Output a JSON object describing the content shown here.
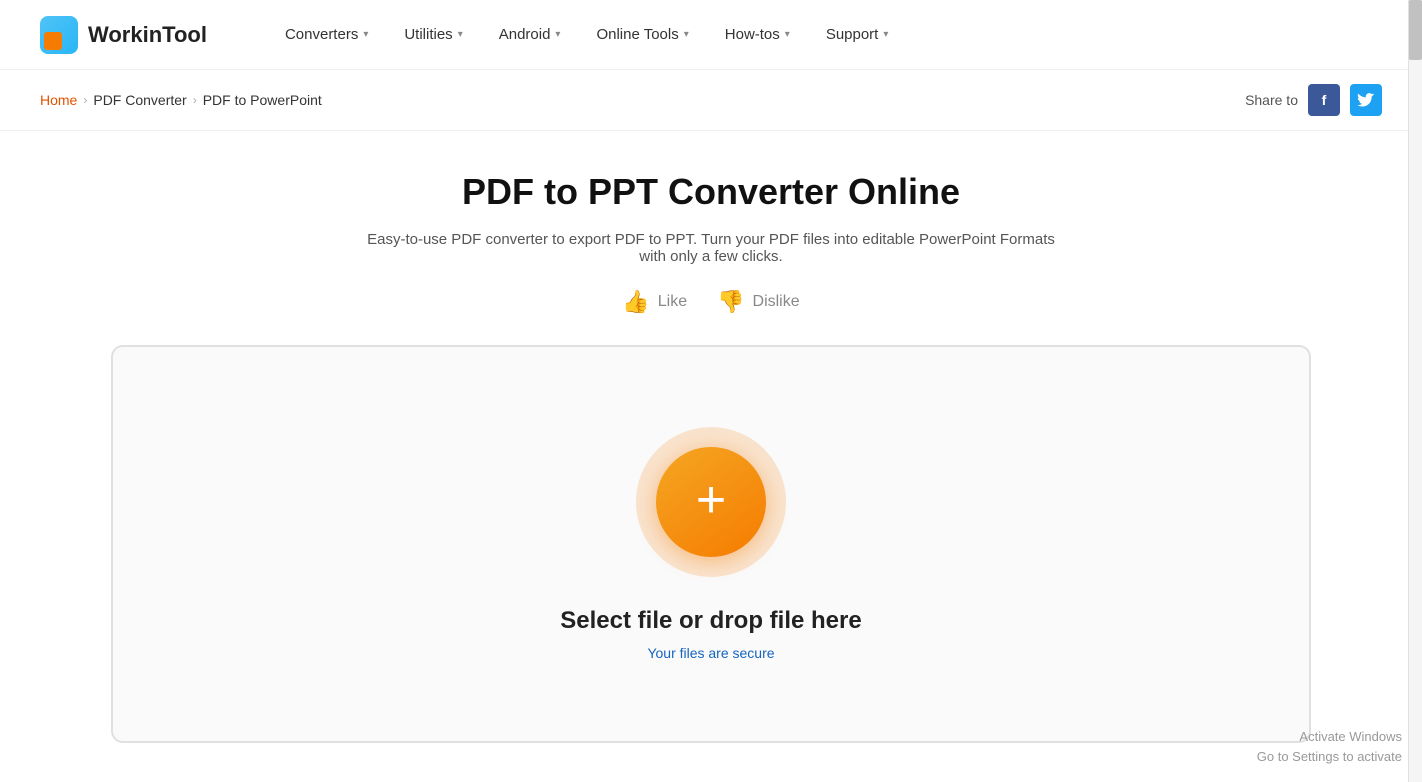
{
  "logo": {
    "text": "WorkinTool"
  },
  "nav": {
    "items": [
      {
        "label": "Converters",
        "has_dropdown": true
      },
      {
        "label": "Utilities",
        "has_dropdown": true
      },
      {
        "label": "Android",
        "has_dropdown": true
      },
      {
        "label": "Online Tools",
        "has_dropdown": true
      },
      {
        "label": "How-tos",
        "has_dropdown": true
      },
      {
        "label": "Support",
        "has_dropdown": true
      }
    ]
  },
  "breadcrumb": {
    "home": "Home",
    "separator1": "›",
    "middle": "PDF Converter",
    "separator2": "›",
    "current": "PDF to PowerPoint"
  },
  "share": {
    "label": "Share to",
    "facebook_label": "f",
    "twitter_label": "t"
  },
  "page": {
    "title": "PDF to PPT Converter Online",
    "description": "Easy-to-use PDF converter to export PDF to PPT. Turn your PDF files into editable PowerPoint Formats with only a few clicks.",
    "like_label": "Like",
    "dislike_label": "Dislike"
  },
  "upload": {
    "main_text": "Select file or drop file here",
    "secure_text": "Your files are secure",
    "plus_icon": "+"
  },
  "activate_windows": {
    "line1": "Activate Windows",
    "line2": "Go to Settings to activate"
  }
}
